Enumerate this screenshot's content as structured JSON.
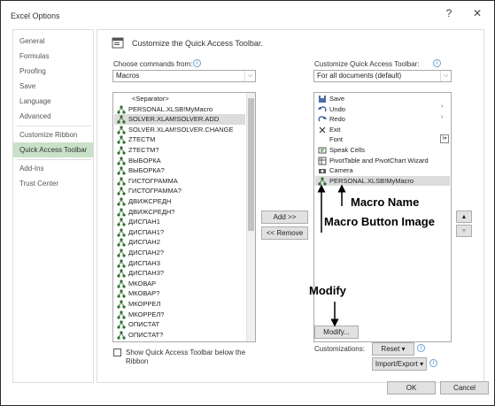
{
  "window": {
    "title": "Excel Options",
    "help": "?",
    "close": "✕"
  },
  "sidebar": {
    "items": [
      {
        "label": "General"
      },
      {
        "label": "Formulas"
      },
      {
        "label": "Proofing"
      },
      {
        "label": "Save"
      },
      {
        "label": "Language"
      },
      {
        "label": "Advanced"
      },
      {
        "label": "Customize Ribbon"
      },
      {
        "label": "Quick Access Toolbar",
        "selected": true
      },
      {
        "label": "Add-Ins"
      },
      {
        "label": "Trust Center"
      }
    ]
  },
  "main": {
    "header": "Customize the Quick Access Toolbar.",
    "choose_label": "Choose commands from:",
    "choose_value": "Macros",
    "customize_label": "Customize Quick Access Toolbar:",
    "customize_value": "For all documents (default)",
    "left_list": [
      "<Separator>",
      "PERSONAL.XLSB!MyMacro",
      "SOLVER.XLAM!SOLVER.ADD",
      "SOLVER.XLAM!SOLVER.CHANGE",
      "ZTECTM",
      "ZTECTM?",
      "ВЫБОРКА",
      "ВЫБОРКА?",
      "ГИСТОГРАММА",
      "ГИСТОГРАММА?",
      "ДВИЖСРЕДН",
      "ДВИЖСРЕДН?",
      "ДИСПАН1",
      "ДИСПАН1?",
      "ДИСПАН2",
      "ДИСПАН2?",
      "ДИСПАН3",
      "ДИСПАН3?",
      "МКОВАР",
      "МКОВАР?",
      "МКОРРЕЛ",
      "МКОРРЕЛ?",
      "ОПИСТАТ",
      "ОПИСТАТ?"
    ],
    "right_list": [
      {
        "label": "Save",
        "icon": "save-icon"
      },
      {
        "label": "Undo",
        "icon": "undo-icon"
      },
      {
        "label": "Redo",
        "icon": "redo-icon"
      },
      {
        "label": "Exit",
        "icon": "exit-icon"
      },
      {
        "label": "Font",
        "icon": "blank"
      },
      {
        "label": "Speak Cells",
        "icon": "speak-cells-icon"
      },
      {
        "label": "PivotTable and PivotChart Wizard",
        "icon": "pivot-icon"
      },
      {
        "label": "Camera",
        "icon": "camera-icon"
      },
      {
        "label": "PERSONAL.XLSB!MyMacro",
        "icon": "macro-icon",
        "selected": true
      }
    ],
    "add_button": "Add >>",
    "remove_button": "<< Remove",
    "show_below_label": "Show Quick Access Toolbar below the Ribbon",
    "modify_button": "Modify...",
    "customizations_label": "Customizations:",
    "reset_button": "Reset ▾",
    "import_export_button": "Import/Export ▾"
  },
  "annotations": {
    "macro_name": "Macro Name",
    "macro_button_image": "Macro Button Image",
    "modify": "Modify"
  },
  "footer": {
    "ok": "OK",
    "cancel": "Cancel"
  },
  "colors": {
    "accent": "#c9e1c9",
    "selection": "#dcdcdc",
    "macro_icon": "#2e6e2e"
  }
}
